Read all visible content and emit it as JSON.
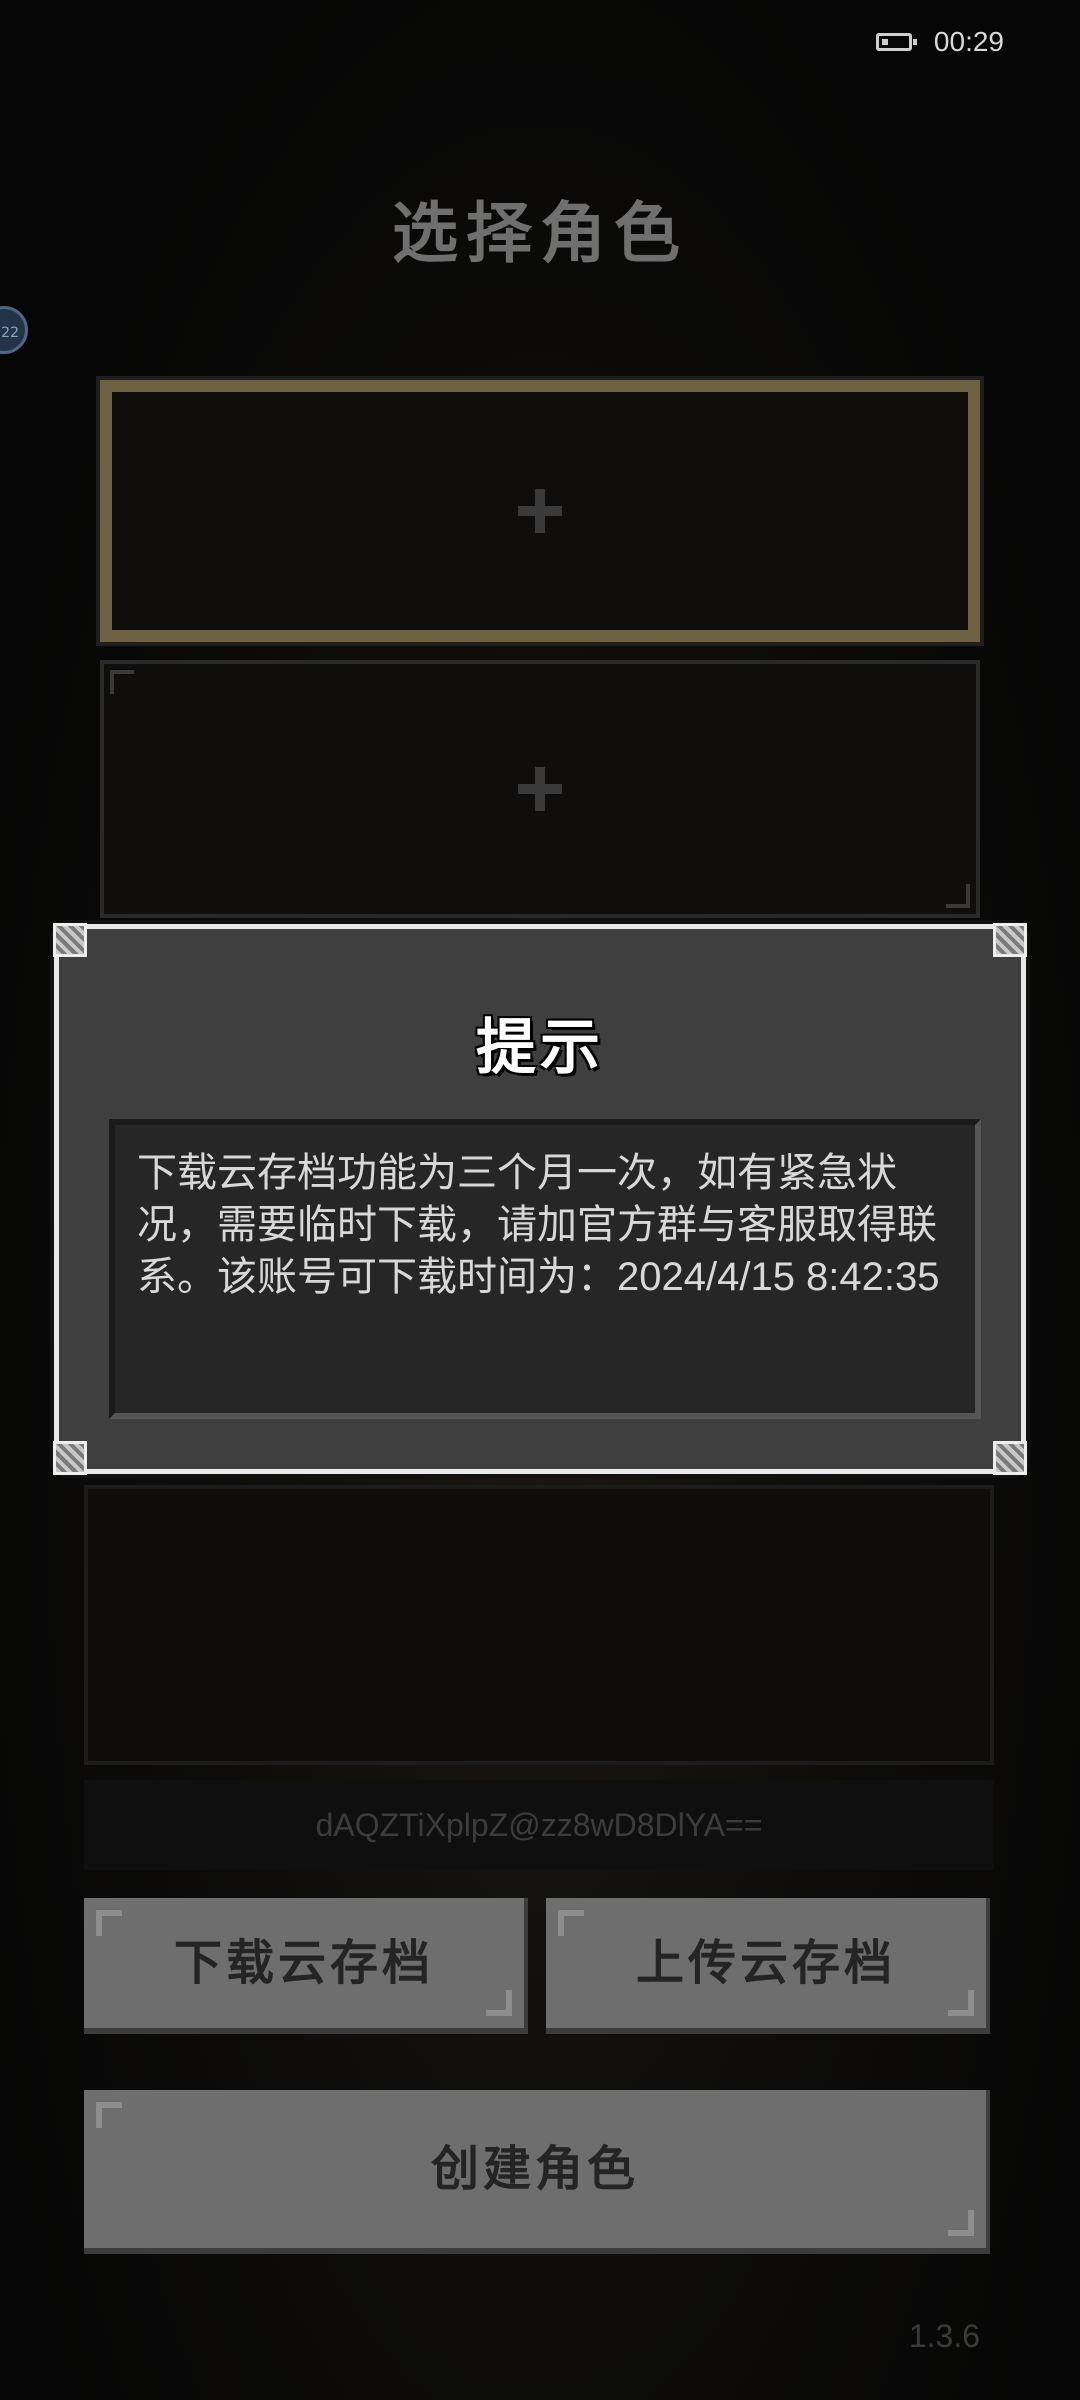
{
  "status_bar": {
    "time": "00:29",
    "battery_icon": "battery-low-icon"
  },
  "title": "选择角色",
  "side_badge": "22",
  "slots": [
    {
      "icon": "plus-icon",
      "selected": true
    },
    {
      "icon": "plus-icon",
      "selected": false
    }
  ],
  "dialog": {
    "title": "提示",
    "message": "下载云存档功能为三个月一次，如有紧急状况，需要临时下载，请加官方群与客服取得联系。该账号可下载时间为：2024/4/15 8:42:35"
  },
  "account_id": "dAQZTiXplpZ@zz8wD8DlYA==",
  "buttons": {
    "download": "下载云存档",
    "upload": "上传云存档",
    "create": "创建角色"
  },
  "version": "1.3.6",
  "colors": {
    "selected_border": "#6e6243",
    "button_bg": "#6e6e6e",
    "dialog_bg": "#3f3f3f"
  }
}
